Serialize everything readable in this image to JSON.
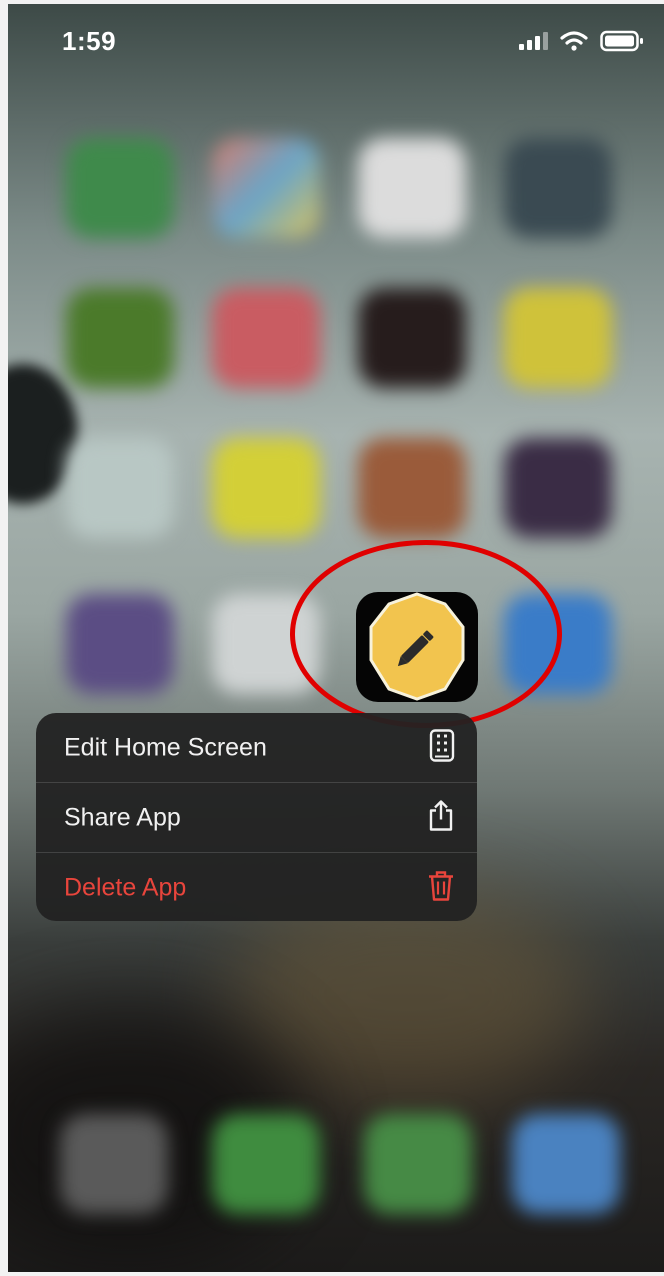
{
  "status_bar": {
    "time": "1:59"
  },
  "app": {
    "icon_name": "pencil-icon",
    "tile_color": "#f2c44e"
  },
  "context_menu": {
    "items": [
      {
        "label": "Edit Home Screen",
        "icon": "home-screen-icon",
        "color": "#f1f1f1"
      },
      {
        "label": "Share App",
        "icon": "share-icon",
        "color": "#f1f1f1"
      },
      {
        "label": "Delete App",
        "icon": "trash-icon",
        "color": "#e8453c"
      }
    ]
  },
  "highlight": {
    "color": "#e00000"
  }
}
